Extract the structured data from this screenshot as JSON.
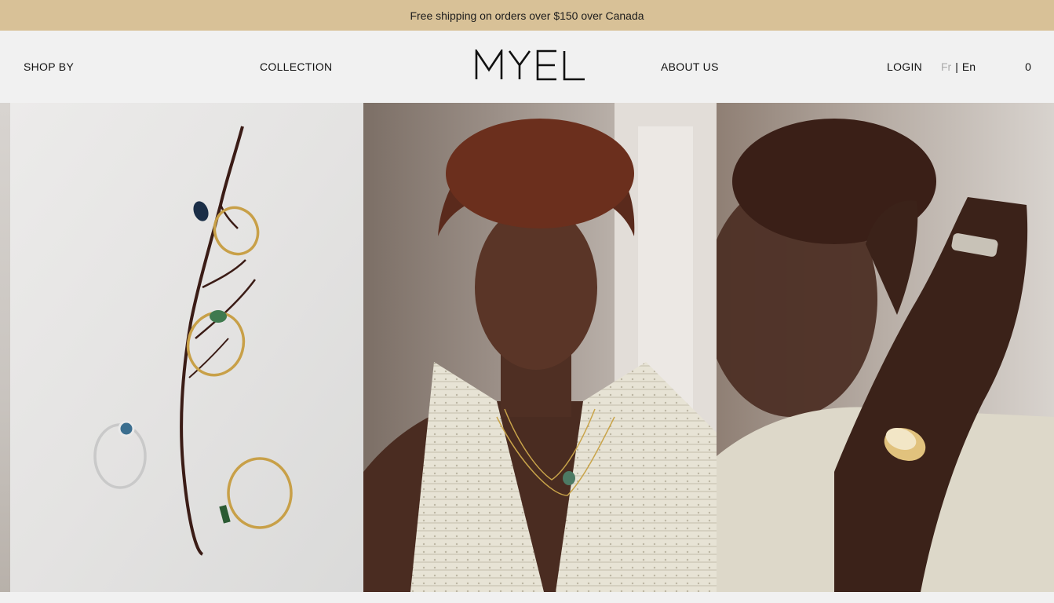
{
  "announcement": {
    "text": "Free shipping on orders over $150 over Canada"
  },
  "header": {
    "nav_left": [
      {
        "label": "SHOP BY"
      },
      {
        "label": "COLLECTION"
      }
    ],
    "logo_text": "MYEL",
    "nav_right": [
      {
        "label": "ABOUT US"
      }
    ],
    "login_label": "LOGIN",
    "language": {
      "fr": "Fr",
      "separator": "|",
      "en": "En",
      "active": "En"
    },
    "cart_count": "0"
  },
  "gallery": {
    "images": [
      {
        "name": "rings-on-branch-image",
        "alt_visible": ""
      },
      {
        "name": "model-necklace-image",
        "alt_visible": ""
      },
      {
        "name": "model-hands-rings-image",
        "alt_visible": ""
      }
    ]
  },
  "colors": {
    "announcement_bg": "#d8c197",
    "header_bg": "#f1f1f1",
    "text": "#111111",
    "inactive_lang": "#aaaaaa"
  }
}
